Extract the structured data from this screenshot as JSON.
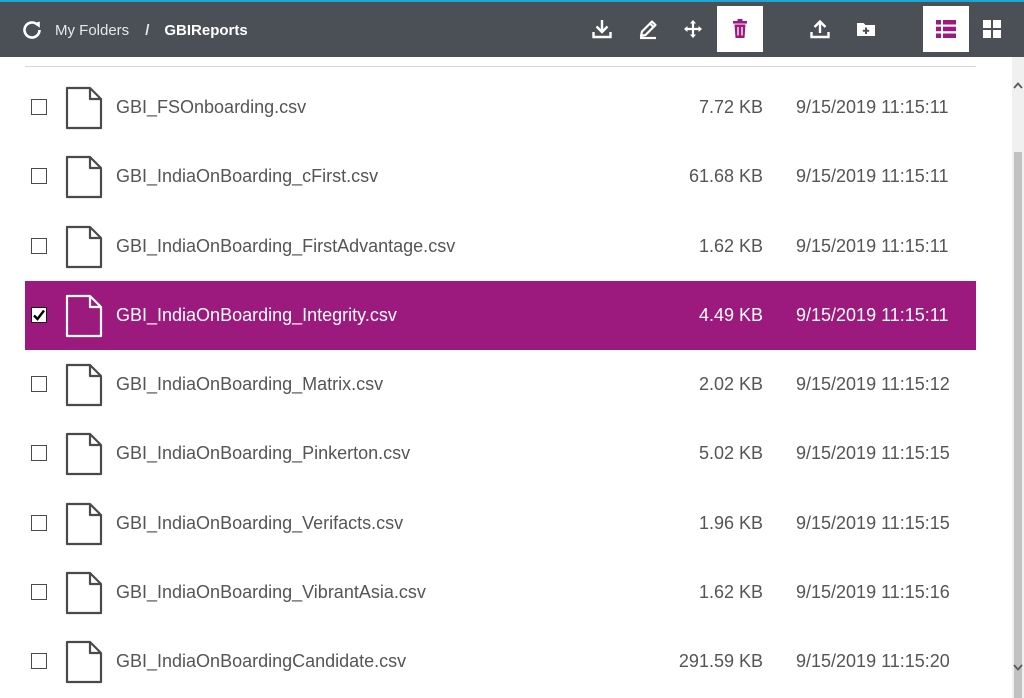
{
  "breadcrumb": {
    "root": "My Folders",
    "separator": "/",
    "current": "GBIReports"
  },
  "toolbar": {
    "buttons": [
      {
        "name": "download",
        "icon": "download-icon",
        "active": false
      },
      {
        "name": "rename",
        "icon": "pencil-icon",
        "active": false
      },
      {
        "name": "move",
        "icon": "move-icon",
        "active": false
      },
      {
        "name": "delete",
        "icon": "trash-icon",
        "active": true
      },
      {
        "name": "upload",
        "icon": "upload-icon",
        "active": false
      },
      {
        "name": "new-folder",
        "icon": "folder-plus-icon",
        "active": false
      },
      {
        "name": "list-view",
        "icon": "list-view-icon",
        "active": true
      },
      {
        "name": "grid-view",
        "icon": "grid-view-icon",
        "active": false
      }
    ]
  },
  "files": [
    {
      "name": "GBI_FSOnboarding.csv",
      "size": "7.72 KB",
      "modified": "9/15/2019 11:15:11",
      "checked": false
    },
    {
      "name": "GBI_IndiaOnBoarding_cFirst.csv",
      "size": "61.68 KB",
      "modified": "9/15/2019 11:15:11",
      "checked": false
    },
    {
      "name": "GBI_IndiaOnBoarding_FirstAdvantage.csv",
      "size": "1.62 KB",
      "modified": "9/15/2019 11:15:11",
      "checked": false
    },
    {
      "name": "GBI_IndiaOnBoarding_Integrity.csv",
      "size": "4.49 KB",
      "modified": "9/15/2019 11:15:11",
      "checked": true
    },
    {
      "name": "GBI_IndiaOnBoarding_Matrix.csv",
      "size": "2.02 KB",
      "modified": "9/15/2019 11:15:12",
      "checked": false
    },
    {
      "name": "GBI_IndiaOnBoarding_Pinkerton.csv",
      "size": "5.02 KB",
      "modified": "9/15/2019 11:15:15",
      "checked": false
    },
    {
      "name": "GBI_IndiaOnBoarding_Verifacts.csv",
      "size": "1.96 KB",
      "modified": "9/15/2019 11:15:15",
      "checked": false
    },
    {
      "name": "GBI_IndiaOnBoarding_VibrantAsia.csv",
      "size": "1.62 KB",
      "modified": "9/15/2019 11:15:16",
      "checked": false
    },
    {
      "name": "GBI_IndiaOnBoardingCandidate.csv",
      "size": "291.59 KB",
      "modified": "9/15/2019 11:15:20",
      "checked": false
    }
  ],
  "colors": {
    "toolbar": "#4a5055",
    "accent": "#9c1a7d",
    "top_border": "#1aa6d6",
    "text": "#555555"
  }
}
